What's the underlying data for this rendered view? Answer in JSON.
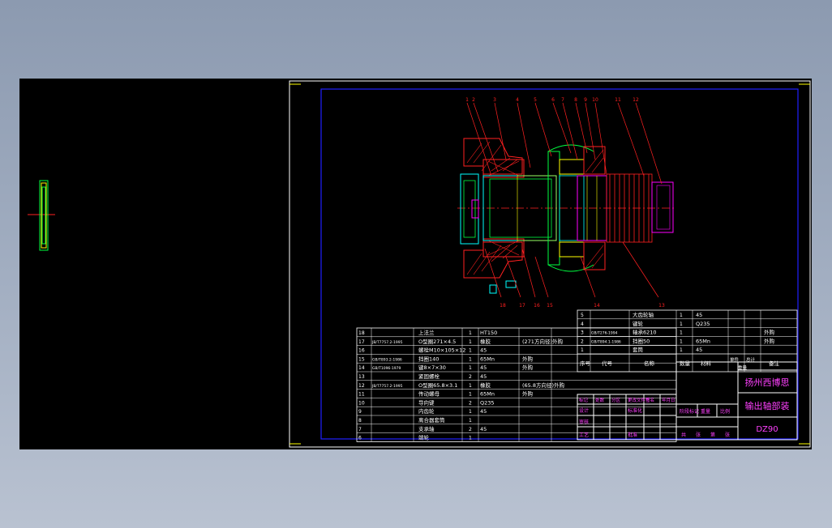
{
  "colors": {
    "background": "#8c9ab0",
    "model_space": "#000000",
    "sheet_border": "#ffffff",
    "inner_frame": "#2020ff",
    "callout": "#ff2020",
    "part_green": "#00ff40",
    "part_cyan": "#00ffff",
    "part_magenta": "#ff00ff",
    "table_line": "#ffffff",
    "title_magenta": "#ff40ff"
  },
  "balloons": {
    "top": [
      "1",
      "2",
      "3",
      "4",
      "5",
      "6",
      "7",
      "8",
      "9",
      "10",
      "11",
      "12"
    ],
    "bottom": [
      "18",
      "17",
      "16",
      "15",
      "14",
      "13"
    ]
  },
  "bom_right": [
    {
      "no": "5",
      "name": "大齿轮轴",
      "qty": "1",
      "material": "45",
      "note": ""
    },
    {
      "no": "4",
      "name": "键轮",
      "qty": "1",
      "material": "Q235",
      "note": ""
    },
    {
      "no": "3",
      "code": "GB/T276-1994",
      "name": "轴承6210",
      "qty": "1",
      "material": "",
      "note": "外购"
    },
    {
      "no": "2",
      "code": "GB/T894.1-1986",
      "name": "挡圈50",
      "qty": "1",
      "material": "65Mn",
      "note": "外购"
    },
    {
      "no": "1",
      "code": "",
      "name": "套筒",
      "qty": "1",
      "material": "45",
      "note": ""
    }
  ],
  "bom_header_right": {
    "no": "序号",
    "code": "代号",
    "name": "名称",
    "qty": "数量",
    "material": "材料",
    "unit_weight": "单件",
    "total_weight": "总计",
    "weight": "重量",
    "note": "备注"
  },
  "bom_left": [
    {
      "no": "18",
      "code": "",
      "name": "上法兰",
      "qty": "1",
      "material": "HT150",
      "note": ""
    },
    {
      "no": "17",
      "code": "JB/T7757.2-1995",
      "name": "O型圈271×4.5",
      "qty": "1",
      "material": "橡胶",
      "note": "(271方向径)外购"
    },
    {
      "no": "16",
      "code": "",
      "name": "螺栓M10×105×12",
      "qty": "1",
      "material": "45",
      "note": ""
    },
    {
      "no": "15",
      "code": "GB/T893.2-1986",
      "name": "挡圈140",
      "qty": "1",
      "material": "65Mn",
      "note": "外购"
    },
    {
      "no": "14",
      "code": "GB/T1096-1979",
      "name": "键8×7×30",
      "qty": "1",
      "material": "45",
      "note": "外购"
    },
    {
      "no": "13",
      "code": "",
      "name": "紧固螺栓",
      "qty": "2",
      "material": "45",
      "note": ""
    },
    {
      "no": "12",
      "code": "JB/T7757.2-1995",
      "name": "O型圈65.8×3.1",
      "qty": "1",
      "material": "橡胶",
      "note": "(65.8方向径)外购"
    },
    {
      "no": "11",
      "code": "",
      "name": "传动螺母",
      "qty": "1",
      "material": "65Mn",
      "note": "外购"
    },
    {
      "no": "10",
      "code": "",
      "name": "导向键",
      "qty": "2",
      "material": "Q235",
      "note": ""
    },
    {
      "no": "9",
      "code": "",
      "name": "内齿轮",
      "qty": "1",
      "material": "45",
      "note": ""
    },
    {
      "no": "8",
      "code": "",
      "name": "离合器套筒",
      "qty": "1",
      "material": "",
      "note": ""
    },
    {
      "no": "7",
      "code": "",
      "name": "支承轴",
      "qty": "2",
      "material": "45",
      "note": ""
    },
    {
      "no": "6",
      "code": "",
      "name": "端轮",
      "qty": "1",
      "material": "",
      "note": ""
    }
  ],
  "title_block": {
    "revision_row": [
      "标记",
      "处数",
      "分区",
      "更改文件号",
      "签名",
      "年月日"
    ],
    "design_row": [
      "设计",
      "",
      "",
      "标准化",
      ""
    ],
    "check_row": [
      "审核",
      "",
      "",
      "",
      ""
    ],
    "process_row": [
      "工艺",
      "",
      "",
      "批准",
      ""
    ],
    "stage_row": [
      "阶段标记",
      "重量",
      "比例"
    ],
    "sheet_row": [
      "共",
      "张",
      "第",
      "张"
    ],
    "company": "扬州西博思",
    "drawing_name": "输出轴部装",
    "drawing_no": "DZ90"
  }
}
